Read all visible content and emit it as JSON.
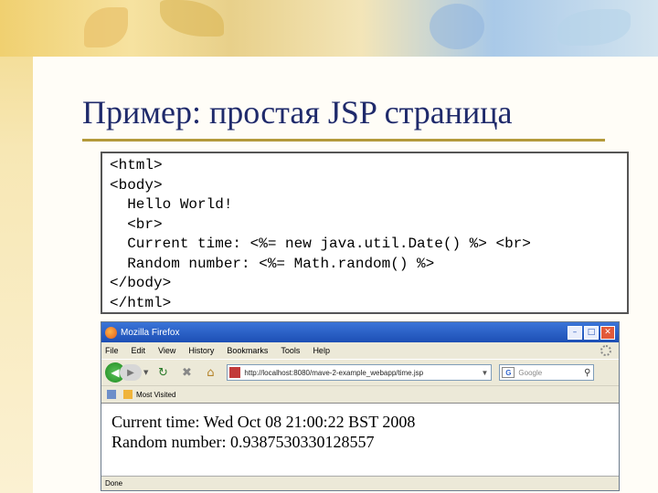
{
  "slide": {
    "title": "Пример: простая JSP страница",
    "code_lines": [
      "<html>",
      "<body>",
      "  Hello World!",
      "  <br>",
      "  Current time: <%= new java.util.Date() %> <br>",
      "  Random number: <%= Math.random() %>",
      "</body>",
      "</html>"
    ]
  },
  "browser": {
    "window_title": "Mozilla Firefox",
    "menu": [
      "File",
      "Edit",
      "View",
      "History",
      "Bookmarks",
      "Tools",
      "Help"
    ],
    "url": "http://localhost:8080/mave-2-example_webapp/time.jsp",
    "search_placeholder": "Google",
    "bookmark_item": "Most Visited",
    "content_lines": [
      "Current time: Wed Oct 08 21:00:22 BST 2008",
      "Random number: 0.9387530330128557"
    ],
    "status": "Done"
  },
  "colors": {
    "title": "#1f2a6b",
    "titlebar": "#1d4fb5",
    "rule": "#b49a3a"
  }
}
